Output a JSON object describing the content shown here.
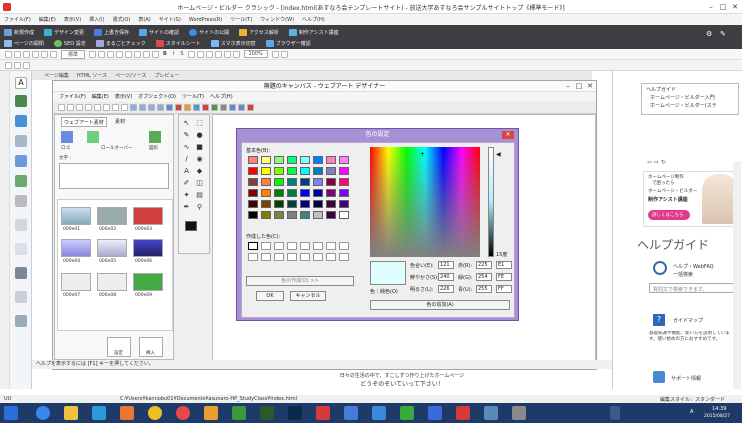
{
  "app": {
    "title": "ホームページ・ビルダー クラシック - [index.html(あすなろ会テンプレートサイト) - 放送大学あすなろ会サンプルサイトトップ《標準モード》]",
    "menu": [
      "ファイル(F)",
      "編集(E)",
      "表示(V)",
      "挿入(I)",
      "書式(O)",
      "表(A)",
      "サイト(S)",
      "WordPress(R)",
      "ツール(T)",
      "ウィンドウ(W)",
      "ヘルプ(H)"
    ]
  },
  "ribbon": {
    "row1": [
      "新規作成",
      "デザイン変更",
      "上書き保存",
      "サイトの確認",
      "サイトの公開",
      "アクセス解析",
      "制作アシスト講座"
    ],
    "row2": [
      "ページの開閉",
      "SEO 設定",
      "まるごとチェック",
      "スタイルシート",
      "スマホ表示切替",
      "ブラウザー確認"
    ]
  },
  "toolbar1": {
    "style_value": "標準",
    "size_value": "100%"
  },
  "doc_tabs": [
    "ページ編集",
    "HTML ソース",
    "ページ/ソース",
    "プレビュー"
  ],
  "designer": {
    "title": "無題のキャンバス - ウェブアート デザイナー",
    "menu": [
      "ファイル(F)",
      "編集(E)",
      "表示(V)",
      "オブジェクト(O)",
      "ツール(T)",
      "ヘルプ(H)"
    ]
  },
  "material_panel": {
    "tabs": [
      "ウェブアート素材",
      "素材"
    ],
    "categories": [
      "ロゴ",
      "ロールオーバー",
      "図形"
    ],
    "text_label": "文字 :",
    "thumbs": [
      "000e01",
      "000e02",
      "000e03",
      "000e04",
      "000e05",
      "000e06",
      "000e07",
      "000e08",
      "000e09"
    ],
    "buttons": [
      "設定",
      "挿入"
    ]
  },
  "color_dialog": {
    "title": "色の設定",
    "basic_label": "基本色(B):",
    "custom_label": "作成した色(C):",
    "define_button": "色の作成(D) >>",
    "ok": "OK",
    "cancel": "キャンセル",
    "add_button": "色の追加(A)",
    "sample_label": "色｜純色(O)",
    "hue_label": "色合い(E):",
    "hue": "121",
    "sat_label": "鮮やかさ(S):",
    "sat": "240",
    "lum_label": "明るさ(L):",
    "lum": "226",
    "red_label": "赤(R):",
    "red": "225",
    "green_label": "緑(G):",
    "green": "254",
    "blue_label": "青(U):",
    "blue": "255",
    "hex_r": "E1",
    "hex_g": "FE",
    "hex_b": "FF",
    "luminance_scale": "15度"
  },
  "basic_colors": [
    "#ff8080",
    "#ffff80",
    "#80ff80",
    "#00ff80",
    "#80ffff",
    "#0080ff",
    "#ff80c0",
    "#ff80ff",
    "#ff0000",
    "#ffff00",
    "#80ff00",
    "#00ff40",
    "#00ffff",
    "#0080c0",
    "#8080c0",
    "#ff00ff",
    "#804040",
    "#ff8040",
    "#00ff00",
    "#008080",
    "#004080",
    "#8080ff",
    "#800040",
    "#ff0080",
    "#800000",
    "#ff8000",
    "#008000",
    "#008040",
    "#0000ff",
    "#0000a0",
    "#800080",
    "#8000ff",
    "#400000",
    "#804000",
    "#004000",
    "#004040",
    "#000080",
    "#000040",
    "#400040",
    "#400080",
    "#000000",
    "#808000",
    "#808040",
    "#808080",
    "#408080",
    "#c0c0c0",
    "#400040",
    "#ffffff"
  ],
  "right_sidebar": {
    "tree": [
      "ヘルプガイド",
      "ホームページ・ビルダー入門",
      "ホームページ・ビルダー(ステ"
    ],
    "promo": [
      "ホームページ制作",
      "で困ったら",
      "ホームページ・ビルダー",
      "制作アシスト講座",
      "詳しくはこちら"
    ],
    "help_guide": "ヘルプガイド",
    "help_webfaq": "ヘルプ・WebFAQ",
    "help_search": "一括検索",
    "search_placeholder": "質問文で検索できます。",
    "guide_map": "ガイドマップ",
    "guide_desc": "基礎知識や機能、使い方を説明しています。使い始めの方におすすめです。",
    "support": "サポート情報"
  },
  "helpbar": "ヘルプを表示するには [F1] キーを押してください。",
  "bottom_text": [
    "日々の生活の中で、すこしずつ作り上げたホームページ",
    "どうぞのぞいていって下さい！"
  ],
  "pathbar": {
    "left": "UU",
    "path": "C:¥Users¥kannobu01¥Documents¥asunaro-HP_StudyClass¥index.html",
    "mode": "編集スタイル：スタンダード"
  },
  "taskbar": {
    "time": "14:39",
    "date": "2015/08/27",
    "lang": "A"
  },
  "colors": {
    "taskbar": "#1e3a68",
    "dialog_frame": "#a98fd4",
    "ribbon": "#3e3e42",
    "promo_pink": "#e03a8a"
  }
}
